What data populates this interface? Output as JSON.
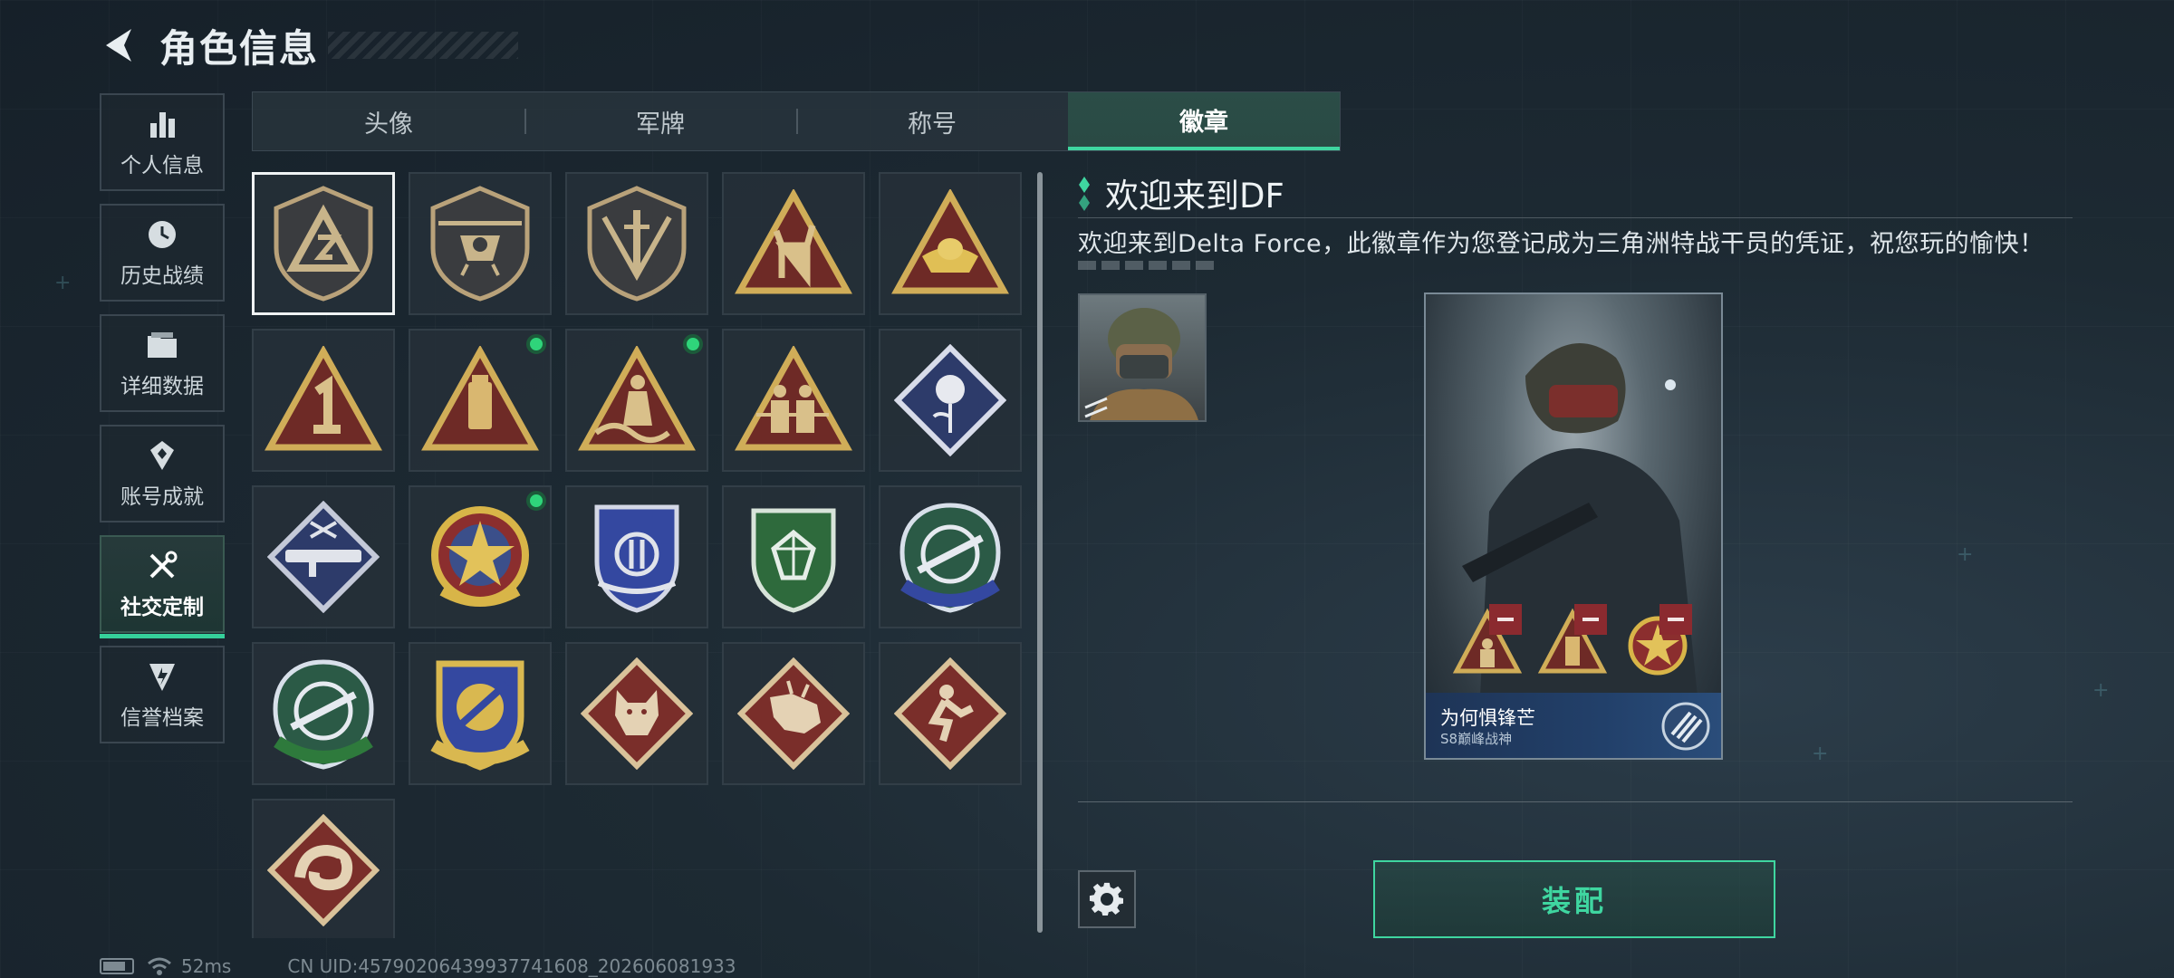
{
  "header": {
    "title": "角色信息"
  },
  "sidebar": {
    "items": [
      {
        "label": "个人信息",
        "icon": "bar-chart-icon"
      },
      {
        "label": "历史战绩",
        "icon": "clock-icon"
      },
      {
        "label": "详细数据",
        "icon": "folder-icon"
      },
      {
        "label": "账号成就",
        "icon": "medal-icon"
      },
      {
        "label": "社交定制",
        "icon": "tools-icon",
        "active": true
      },
      {
        "label": "信誉档案",
        "icon": "shield-icon"
      }
    ]
  },
  "tabs": [
    {
      "label": "头像"
    },
    {
      "label": "军牌"
    },
    {
      "label": "称号"
    },
    {
      "label": "徽章",
      "active": true
    }
  ],
  "badges": [
    {
      "name": "triangle-shield-badge",
      "selected": true,
      "new": false
    },
    {
      "name": "helicopter-shield-badge",
      "new": false
    },
    {
      "name": "dagger-shield-badge",
      "new": false
    },
    {
      "name": "rock-hand-triangle-badge",
      "new": false
    },
    {
      "name": "ingot-triangle-badge",
      "new": false
    },
    {
      "name": "number-one-triangle-badge",
      "new": false
    },
    {
      "name": "usb-triangle-badge",
      "new": true
    },
    {
      "name": "wave-figure-triangle-badge",
      "new": true
    },
    {
      "name": "soldiers-triangle-badge",
      "new": false
    },
    {
      "name": "rose-diamond-badge",
      "new": false
    },
    {
      "name": "rocket-launcher-diamond-badge",
      "new": false
    },
    {
      "name": "star-round-badge",
      "new": true
    },
    {
      "name": "blue-emblem-badge",
      "new": false
    },
    {
      "name": "green-gem-shield-badge",
      "new": false
    },
    {
      "name": "blue-rifle-shield-badge",
      "new": false
    },
    {
      "name": "green-rifle-shield-badge",
      "new": false
    },
    {
      "name": "gold-crossed-shield-badge",
      "new": false
    },
    {
      "name": "wolf-diamond-badge",
      "new": false
    },
    {
      "name": "dragon-diamond-badge",
      "new": false
    },
    {
      "name": "runner-diamond-badge",
      "new": false
    },
    {
      "name": "snake-diamond-badge",
      "new": false
    }
  ],
  "detail": {
    "badge_name": "欢迎来到DF",
    "description": "欢迎来到Delta Force，此徽章作为您登记成为三角洲特战干员的凭证，祝您玩的愉快！"
  },
  "card": {
    "player_name": "为何惧锋芒",
    "rank": "S8巅峰战神"
  },
  "buttons": {
    "equip": "装配"
  },
  "status": {
    "ping": "52ms",
    "uid": "CN UID:4579020643993774160​8_202606081933"
  },
  "colors": {
    "accent": "#3fd6a0",
    "new_dot": "#2fd47a",
    "remove": "#8b2a2f"
  }
}
